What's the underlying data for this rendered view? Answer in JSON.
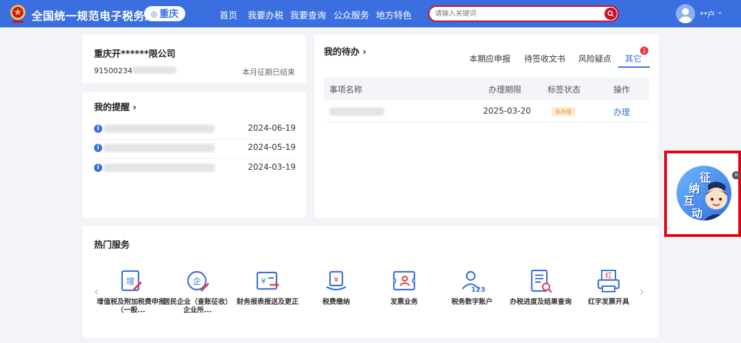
{
  "header": {
    "site_title": "全国统一规范电子税务局",
    "region": "重庆",
    "nav": [
      "首页",
      "我要办税",
      "我要查询",
      "公众服务",
      "地方特色"
    ],
    "search_placeholder": "请输入关键词",
    "user_name": "**户"
  },
  "company": {
    "name": "重庆开******限公司",
    "tax_id_prefix": "91500234",
    "period_status": "本月征期已结束"
  },
  "reminders": {
    "title": "我的提醒",
    "items": [
      {
        "date": "2024-06-19"
      },
      {
        "date": "2024-05-19"
      },
      {
        "date": "2024-03-19"
      }
    ]
  },
  "todos": {
    "title": "我的待办",
    "tabs": [
      "本期应申报",
      "待签收文书",
      "风险疑点",
      "其它"
    ],
    "active_tab": "其它",
    "badge": "1",
    "columns": [
      "事项名称",
      "办理期限",
      "标签状态",
      "操作"
    ],
    "rows": [
      {
        "deadline": "2025-03-20",
        "status": "未办理",
        "action": "办理"
      }
    ]
  },
  "services": {
    "title": "热门服务",
    "items": [
      {
        "label": "增值税及附加税费申报（一般...",
        "icon": "vat-declare-icon"
      },
      {
        "label": "居民企业（查账征收）企业所...",
        "icon": "enterprise-tax-icon"
      },
      {
        "label": "财务报表报送及更正",
        "icon": "financial-report-icon"
      },
      {
        "label": "税费缴纳",
        "icon": "tax-payment-icon"
      },
      {
        "label": "发票业务",
        "icon": "invoice-icon"
      },
      {
        "label": "税务数字账户",
        "icon": "digital-account-icon"
      },
      {
        "label": "办税进度及结果查询",
        "icon": "progress-query-icon"
      },
      {
        "label": "红字发票开具",
        "icon": "red-invoice-icon"
      }
    ]
  },
  "float_widget": {
    "chars": [
      "征",
      "纳",
      "互",
      "动"
    ],
    "close": "×"
  },
  "colors": {
    "primary": "#3b6fe0",
    "highlight_frame": "#e60012",
    "badge": "#e5383b"
  }
}
